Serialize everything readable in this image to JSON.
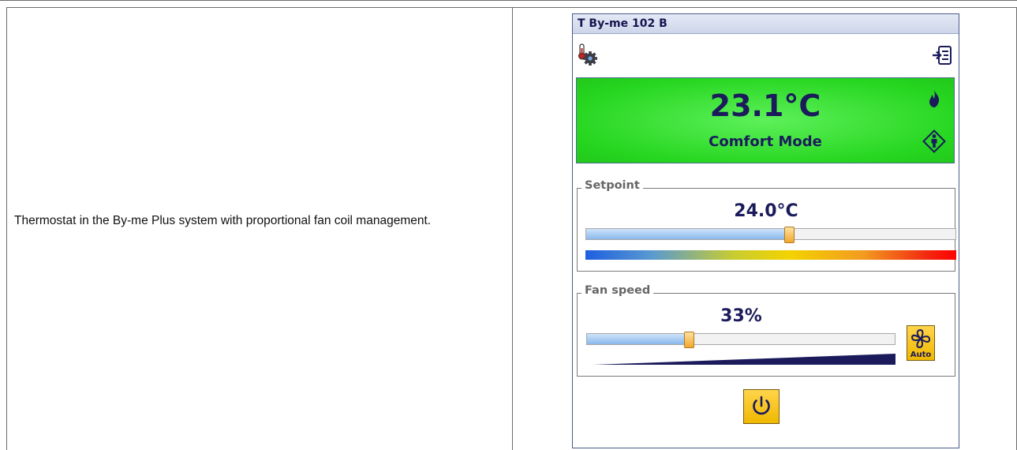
{
  "description": {
    "text": "Thermostat in the By-me Plus system with proportional fan coil management."
  },
  "device": {
    "title": "T By-me 102 B",
    "current_temperature": "23.1°C",
    "mode": "Comfort Mode",
    "setpoint": {
      "legend": "Setpoint",
      "value": "24.0°C",
      "level": 0.55
    },
    "fan": {
      "legend": "Fan speed",
      "value": "33%",
      "level": 0.33,
      "auto_label": "Auto"
    },
    "colors": {
      "status_green": "#26d61f",
      "text_navy": "#1b1b5c",
      "button_yellow": "#f0b800"
    },
    "icons": [
      "thermometer-gear-icon",
      "export-list-icon",
      "flame-icon",
      "comfort-mode-icon",
      "fan-icon",
      "power-icon"
    ]
  }
}
